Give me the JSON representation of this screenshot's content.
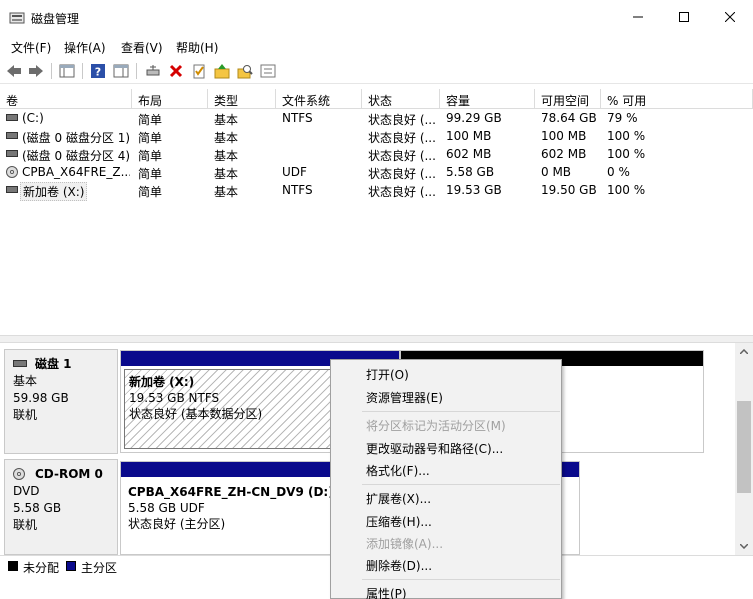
{
  "window": {
    "title": "磁盘管理"
  },
  "menu": [
    "文件(F)",
    "操作(A)",
    "查看(V)",
    "帮助(H)"
  ],
  "volume_list": {
    "columns": [
      "卷",
      "布局",
      "类型",
      "文件系统",
      "状态",
      "容量",
      "可用空间",
      "% 可用"
    ],
    "rows": [
      {
        "name": "(C:)",
        "layout": "简单",
        "type": "基本",
        "fs": "NTFS",
        "status": "状态良好 (...",
        "capacity": "99.29 GB",
        "free": "78.64 GB",
        "pct": "79 %",
        "icon": "disk-drive-icon"
      },
      {
        "name": "(磁盘 0 磁盘分区 1)",
        "layout": "简单",
        "type": "基本",
        "fs": "",
        "status": "状态良好 (...",
        "capacity": "100 MB",
        "free": "100 MB",
        "pct": "100 %",
        "icon": "disk-drive-icon"
      },
      {
        "name": "(磁盘 0 磁盘分区 4)",
        "layout": "简单",
        "type": "基本",
        "fs": "",
        "status": "状态良好 (...",
        "capacity": "602 MB",
        "free": "602 MB",
        "pct": "100 %",
        "icon": "disk-drive-icon"
      },
      {
        "name": "CPBA_X64FRE_Z...",
        "layout": "简单",
        "type": "基本",
        "fs": "UDF",
        "status": "状态良好 (...",
        "capacity": "5.58 GB",
        "free": "0 MB",
        "pct": "0 %",
        "icon": "cd-drive-icon"
      },
      {
        "name": "新加卷 (X:)",
        "layout": "简单",
        "type": "基本",
        "fs": "NTFS",
        "status": "状态良好 (...",
        "capacity": "19.53 GB",
        "free": "19.50 GB",
        "pct": "100 %",
        "icon": "disk-drive-icon"
      }
    ]
  },
  "disks": [
    {
      "name": "磁盘 1",
      "kind": "基本",
      "size": "59.98 GB",
      "state": "联机",
      "partition": {
        "title": "新加卷 (X:)",
        "line1": "19.53 GB NTFS",
        "line2": "状态良好 (基本数据分区)"
      }
    },
    {
      "name": "CD-ROM 0",
      "kind": "DVD",
      "size": "5.58 GB",
      "state": "联机",
      "partition": {
        "title": "CPBA_X64FRE_ZH-CN_DV9 (D:)",
        "line1": "5.58 GB UDF",
        "line2": "状态良好 (主分区)"
      }
    }
  ],
  "legend": [
    {
      "label": "未分配",
      "color": "#000000"
    },
    {
      "label": "主分区",
      "color": "#0a0a8c"
    }
  ],
  "context_menu": [
    {
      "label": "打开(O)",
      "enabled": true
    },
    {
      "label": "资源管理器(E)",
      "enabled": true
    },
    {
      "label": "将分区标记为活动分区(M)",
      "enabled": false
    },
    {
      "label": "更改驱动器号和路径(C)...",
      "enabled": true
    },
    {
      "label": "格式化(F)...",
      "enabled": true
    },
    {
      "label": "扩展卷(X)...",
      "enabled": true
    },
    {
      "label": "压缩卷(H)...",
      "enabled": true
    },
    {
      "label": "添加镜像(A)...",
      "enabled": false
    },
    {
      "label": "删除卷(D)...",
      "enabled": true
    },
    {
      "label": "属性(P)",
      "enabled": true
    }
  ],
  "colors": {
    "primary_partition": "#0a0a8c",
    "unallocated": "#000000",
    "disabled_text": "#a0a0a0"
  }
}
